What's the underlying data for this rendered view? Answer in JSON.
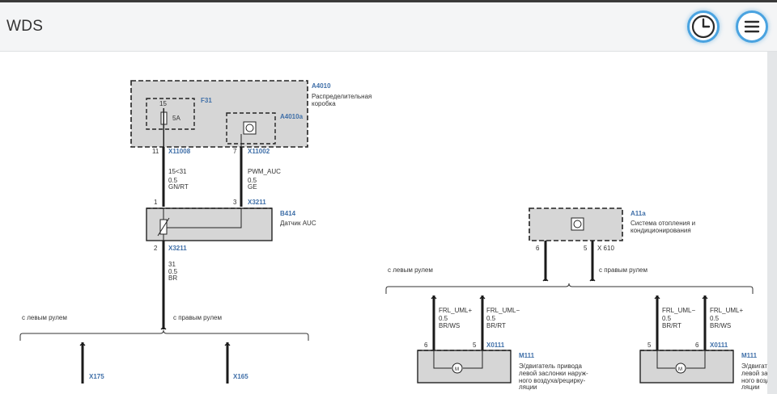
{
  "app": {
    "title": "WDS"
  },
  "header": {
    "history_icon": "clock-icon",
    "menu_icon": "hamburger-menu-icon",
    "accent": "#4aa3e0"
  },
  "diagram": {
    "a4010": {
      "code": "A4010",
      "desc1": "Распределительная",
      "desc2": "коробка"
    },
    "f31": {
      "code": "F31",
      "pin": "15",
      "rating": "5A"
    },
    "a4010a": {
      "code": "A4010a"
    },
    "x11008": {
      "code": "X11008",
      "pin": "11"
    },
    "x11002": {
      "code": "X11002",
      "pin": "7"
    },
    "wire_left_top": {
      "signal": "15<31",
      "size": "0.5",
      "color": "GN/RT"
    },
    "wire_right_top": {
      "signal": "PWM_AUC",
      "size": "0.5",
      "color": "GE"
    },
    "x3211_top": {
      "code": "X3211",
      "pin_left": "1",
      "pin_right": "3"
    },
    "b414": {
      "code": "B414",
      "desc": "Датчик AUC"
    },
    "x3211_bottom": {
      "code": "X3211",
      "pin": "2"
    },
    "wire_ground": {
      "signal": "31",
      "size": "0.5",
      "color": "BR"
    },
    "branch_left": {
      "left_label": "с левым рулем",
      "right_label": "с правым рулем"
    },
    "x175": {
      "code": "X175"
    },
    "x165": {
      "code": "X165"
    },
    "a11a": {
      "code": "A11a",
      "desc1": "Система отопления и",
      "desc2": "кондиционирования"
    },
    "a11a_pins": {
      "pin_left": "6",
      "pin_right": "5",
      "connector": "X 610"
    },
    "branch_right": {
      "left_label": "с левым рулем",
      "right_label": "с правым рулем"
    },
    "m111_left": {
      "code": "M111",
      "desc": [
        "Э/двигатель привода",
        "левой заслонки наруж-",
        "ного воздуха/рецирку-",
        "ляции"
      ],
      "wire1": {
        "signal": "FRL_UML+",
        "size": "0.5",
        "color": "BR/WS",
        "pin": "6"
      },
      "wire2": {
        "signal": "FRL_UML−",
        "size": "0.5",
        "color": "BR/RT",
        "pin": "5"
      },
      "connector": "X0111"
    },
    "m111_right": {
      "code": "M111",
      "desc": [
        "Э/двигатель",
        "левой засло",
        "ного возду",
        "ляции"
      ],
      "wire1": {
        "signal": "FRL_UML−",
        "size": "0.5",
        "color": "BR/RT",
        "pin": "5"
      },
      "wire2": {
        "signal": "FRL_UML+",
        "size": "0.5",
        "color": "BR/WS",
        "pin": "6"
      },
      "connector": "X0111"
    }
  }
}
